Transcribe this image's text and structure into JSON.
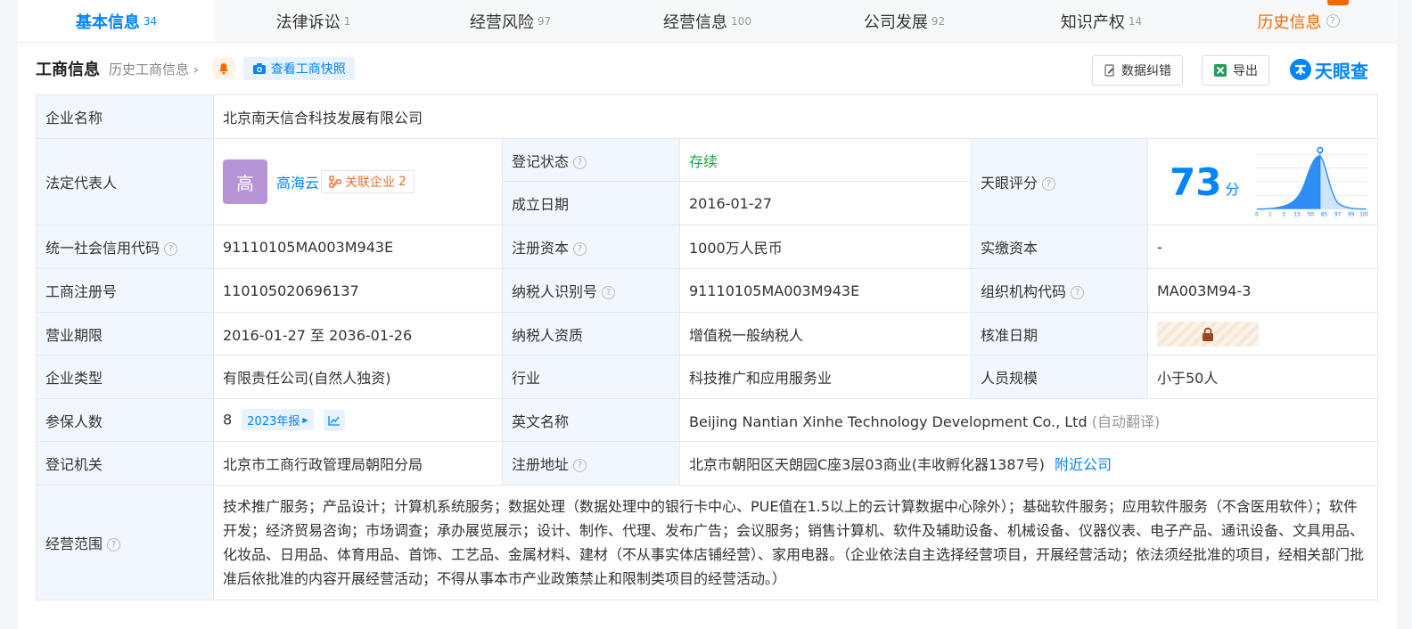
{
  "tabs": [
    {
      "label": "基本信息",
      "count": "34"
    },
    {
      "label": "法律诉讼",
      "count": "1"
    },
    {
      "label": "经营风险",
      "count": "97"
    },
    {
      "label": "经营信息",
      "count": "100"
    },
    {
      "label": "公司发展",
      "count": "92"
    },
    {
      "label": "知识产权",
      "count": "14"
    },
    {
      "label": "历史信息",
      "count": ""
    }
  ],
  "header": {
    "title": "工商信息",
    "history_link": "历史工商信息",
    "snapshot_button": "查看工商快照",
    "correct_button": "数据纠错",
    "export_button": "导出",
    "logo_text": "天眼查"
  },
  "icons": [
    "bell-icon",
    "camera-icon",
    "edit-icon",
    "excel-icon",
    "lock-icon",
    "chart-icon",
    "question-icon"
  ],
  "labels": {
    "company_name": "企业名称",
    "legal_rep": "法定代表人",
    "reg_status": "登记状态",
    "found_date": "成立日期",
    "score": "天眼评分",
    "credit_code": "统一社会信用代码",
    "reg_capital": "注册资本",
    "paid_capital": "实缴资本",
    "reg_no": "工商注册号",
    "taxpayer_id": "纳税人识别号",
    "org_code": "组织机构代码",
    "term": "营业期限",
    "tax_quality": "纳税人资质",
    "approve_date": "核准日期",
    "type": "企业类型",
    "industry": "行业",
    "staff_size": "人员规模",
    "insured": "参保人数",
    "english_name": "英文名称",
    "authority": "登记机关",
    "address": "注册地址",
    "scope": "经营范围"
  },
  "values": {
    "company_name": "北京南天信合科技发展有限公司",
    "legal_rep_avatar": "高",
    "legal_rep_name": "高海云",
    "related_label": "关联企业",
    "related_count": "2",
    "reg_status": "存续",
    "found_date": "2016-01-27",
    "score_value": "73",
    "score_unit": "分",
    "credit_code": "91110105MA003M943E",
    "reg_capital": "1000万人民币",
    "paid_capital": "-",
    "reg_no": "110105020696137",
    "taxpayer_id": "91110105MA003M943E",
    "org_code": "MA003M94-3",
    "term": "2016-01-27 至 2036-01-26",
    "tax_quality": "增值税一般纳税人",
    "type": "有限责任公司(自然人独资)",
    "industry": "科技推广和应用服务业",
    "staff_size": "小于50人",
    "insured": "8",
    "insured_report": "2023年报",
    "english_name": "Beijing Nantian Xinhe Technology Development Co., Ltd",
    "english_note": "(自动翻译)",
    "authority": "北京市工商行政管理局朝阳分局",
    "address": "北京市朝阳区天朗园C座3层03商业(丰收孵化器1387号)",
    "nearby_link": "附近公司",
    "scope": "技术推广服务；产品设计；计算机系统服务；数据处理（数据处理中的银行卡中心、PUE值在1.5以上的云计算数据中心除外）；基础软件服务；应用软件服务（不含医用软件）；软件开发；经济贸易咨询；市场调查；承办展览展示；设计、制作、代理、发布广告；会议服务；销售计算机、软件及辅助设备、机械设备、仪器仪表、电子产品、通讯设备、文具用品、化妆品、日用品、体育用品、首饰、工艺品、金属材料、建材（不从事实体店铺经营）、家用电器。（企业依法自主选择经营项目，开展经营活动；依法须经批准的项目，经相关部门批准后依批准的内容开展经营活动；不得从事本市产业政策禁止和限制类项目的经营活动。）"
  },
  "score_chart": {
    "x_ticks": [
      "0",
      "1",
      "3",
      "15",
      "50",
      "85",
      "97",
      "99",
      "100"
    ],
    "marker_value": "73"
  },
  "colors": {
    "accent": "#0084ff",
    "status": "#1ba344",
    "history": "#f56a00",
    "label_bg": "#f2f7fd"
  }
}
